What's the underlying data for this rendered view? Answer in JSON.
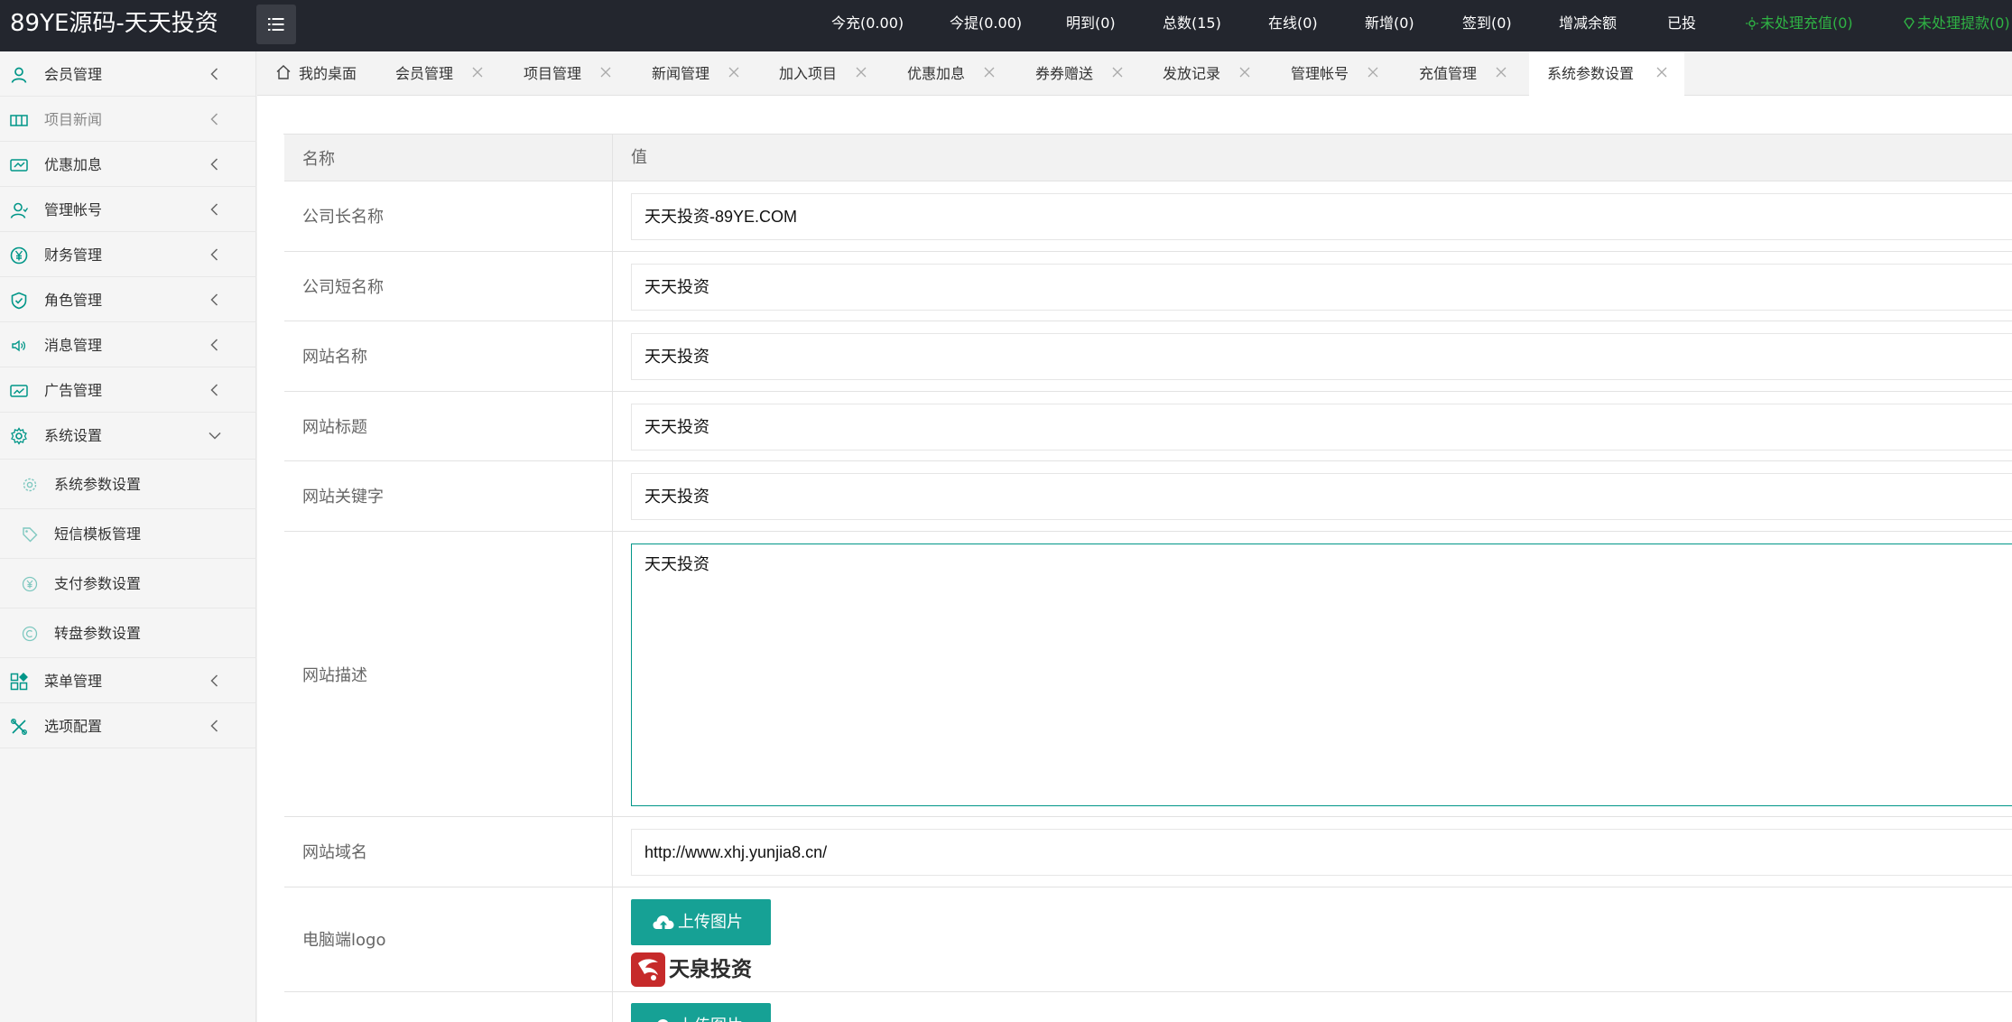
{
  "header": {
    "brand": "89YE源码-天天投资",
    "stats": [
      {
        "label": "今充(0.00)"
      },
      {
        "label": "今提(0.00)"
      },
      {
        "label": "明到(0)"
      },
      {
        "label": "总数(15)"
      },
      {
        "label": "在线(0)"
      },
      {
        "label": "新增(0)"
      },
      {
        "label": "签到(0)"
      },
      {
        "label": "增减余额"
      },
      {
        "label": "已投"
      },
      {
        "label": "未处理充值(0)",
        "color": "#2fb344"
      },
      {
        "label": "未处理提款(0)",
        "color": "#2fb344"
      }
    ]
  },
  "sidebar": {
    "items": [
      {
        "label": "会员管理",
        "icon": "user-icon"
      },
      {
        "label": "项目新闻",
        "icon": "news-icon"
      },
      {
        "label": "优惠加息",
        "icon": "coupon-icon"
      },
      {
        "label": "管理帐号",
        "icon": "admin-icon"
      },
      {
        "label": "财务管理",
        "icon": "yen-icon"
      },
      {
        "label": "角色管理",
        "icon": "shield-icon"
      },
      {
        "label": "消息管理",
        "icon": "speaker-icon"
      },
      {
        "label": "广告管理",
        "icon": "ad-icon"
      },
      {
        "label": "系统设置",
        "icon": "gear-icon"
      }
    ],
    "sub_items": [
      {
        "label": "系统参数设置",
        "icon": "cog-small-icon"
      },
      {
        "label": "短信模板管理",
        "icon": "tag-icon"
      },
      {
        "label": "支付参数设置",
        "icon": "yen-small-icon"
      },
      {
        "label": "转盘参数设置",
        "icon": "wheel-icon"
      }
    ],
    "items_after": [
      {
        "label": "菜单管理",
        "icon": "grid-icon"
      },
      {
        "label": "选项配置",
        "icon": "tools-icon"
      }
    ]
  },
  "tabs": [
    {
      "label": "我的桌面",
      "icon": "home-icon"
    },
    {
      "label": "会员管理"
    },
    {
      "label": "项目管理"
    },
    {
      "label": "新闻管理"
    },
    {
      "label": "加入项目"
    },
    {
      "label": "优惠加息"
    },
    {
      "label": "券券赠送"
    },
    {
      "label": "发放记录"
    },
    {
      "label": "管理帐号"
    },
    {
      "label": "充值管理"
    },
    {
      "label": "系统参数设置",
      "active": true
    }
  ],
  "table": {
    "col_name": "名称",
    "col_value": "值",
    "rows": [
      {
        "name": "公司长名称",
        "value": "天天投资-89YE.COM"
      },
      {
        "name": "公司短名称",
        "value": "天天投资"
      },
      {
        "name": "网站名称",
        "value": "天天投资"
      },
      {
        "name": "网站标题",
        "value": "天天投资"
      },
      {
        "name": "网站关键字",
        "value": "天天投资"
      },
      {
        "name": "网站描述",
        "value": "天天投资"
      },
      {
        "name": "网站域名",
        "value": "http://www.xhj.yunjia8.cn/"
      },
      {
        "name": "电脑端logo",
        "button": "上传图片",
        "logo_text": "天泉投资"
      }
    ],
    "next_button": "上传图片"
  },
  "colors": {
    "header_bg": "#23262e",
    "accent": "#009688",
    "button": "#16a195",
    "status_green": "#2fb344"
  }
}
